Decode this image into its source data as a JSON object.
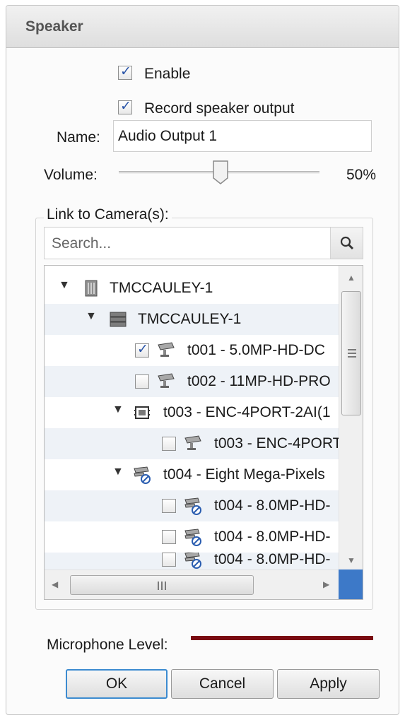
{
  "dialog": {
    "title": "Speaker",
    "enable": {
      "label": "Enable",
      "checked": true
    },
    "record": {
      "label": "Record speaker output",
      "checked": true
    },
    "name": {
      "label": "Name:",
      "value": "Audio Output 1"
    },
    "volume": {
      "label": "Volume:",
      "value_text": "50%",
      "value": 0.5
    },
    "link_group": {
      "legend": "Link to Camera(s):",
      "search_placeholder": "Search..."
    },
    "tree": [
      {
        "label": "TMCCAULEY-1",
        "icon": "server-icon",
        "expanded": true
      },
      {
        "label": "TMCCAULEY-1",
        "icon": "nvr-icon",
        "expanded": true
      },
      {
        "label": "t001 - 5.0MP-HD-DC",
        "icon": "camera-icon",
        "checked": true
      },
      {
        "label": "t002 - 11MP-HD-PRO",
        "icon": "camera-icon",
        "checked": false
      },
      {
        "label": "t003 - ENC-4PORT-2AI(1",
        "icon": "encoder-icon",
        "expanded": true
      },
      {
        "label": "t003 - ENC-4PORT",
        "icon": "camera-icon",
        "checked": false
      },
      {
        "label": "t004 - Eight Mega-Pixels",
        "icon": "camera-disabled-icon",
        "expanded": true
      },
      {
        "label": "t004 - 8.0MP-HD-",
        "icon": "camera-disabled-icon",
        "checked": false
      },
      {
        "label": "t004 - 8.0MP-HD-",
        "icon": "camera-disabled-icon",
        "checked": false
      },
      {
        "label": "t004 - 8.0MP-HD-",
        "icon": "camera-disabled-icon",
        "checked": false
      }
    ],
    "mic_level_label": "Microphone Level:",
    "mic_color": "#7a0a12",
    "buttons": {
      "ok": "OK",
      "cancel": "Cancel",
      "apply": "Apply"
    }
  }
}
